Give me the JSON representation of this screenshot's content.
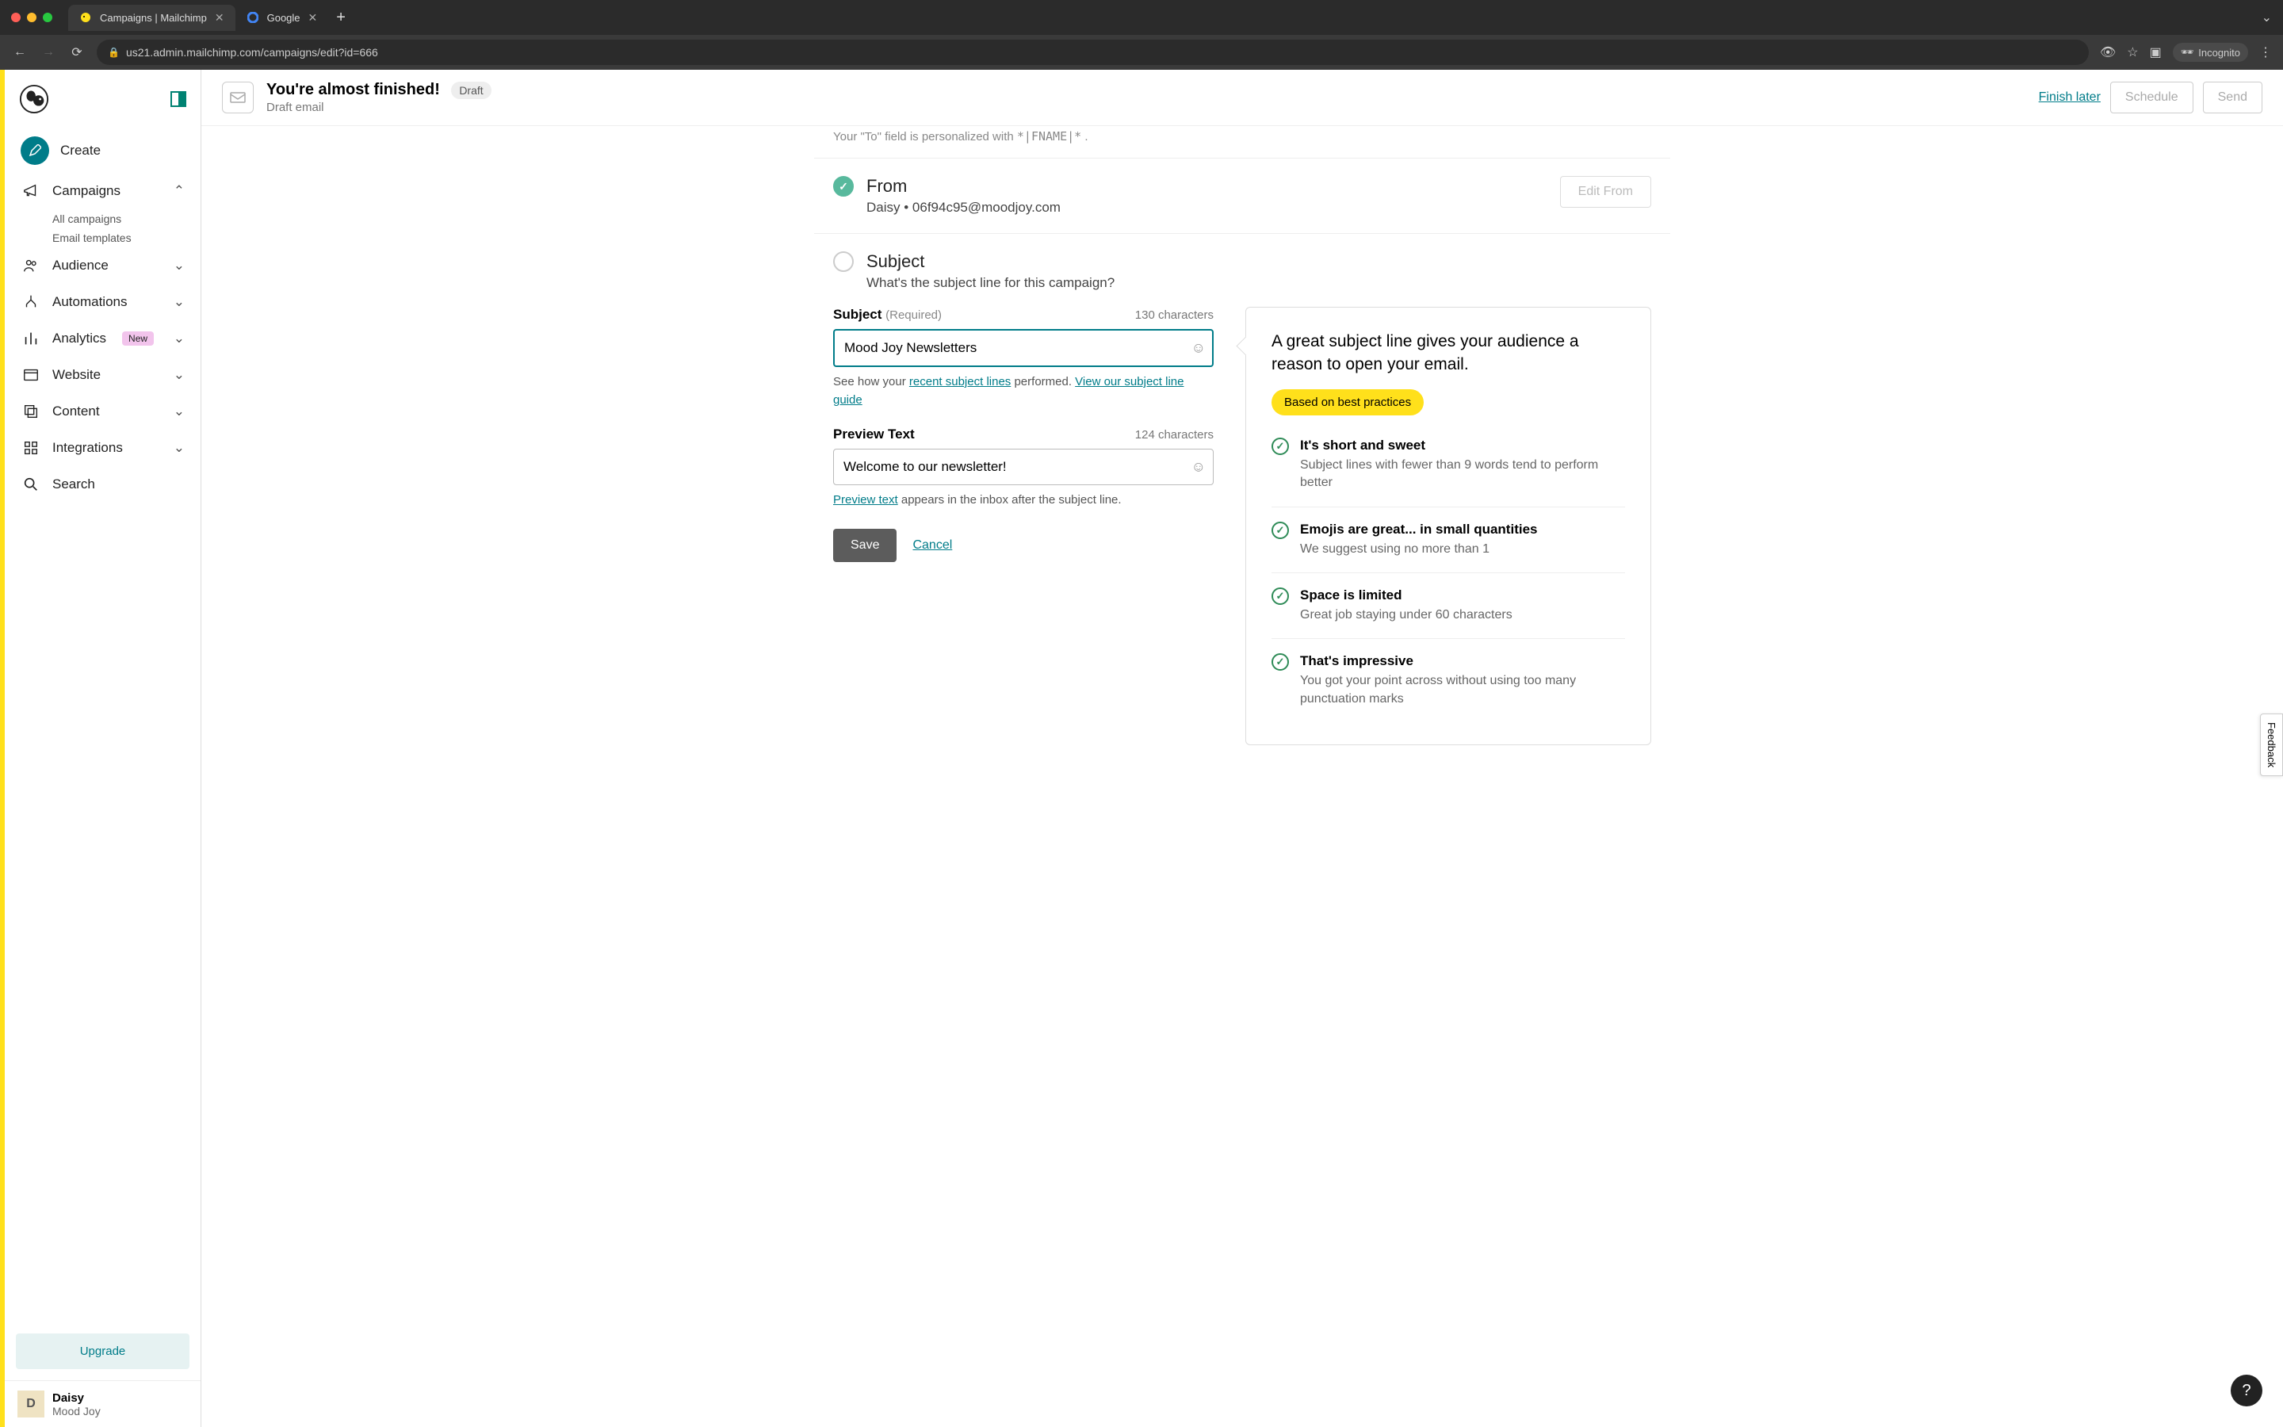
{
  "browser": {
    "tabs": [
      {
        "title": "Campaigns | Mailchimp",
        "active": true
      },
      {
        "title": "Google",
        "active": false
      }
    ],
    "url": "us21.admin.mailchimp.com/campaigns/edit?id=666",
    "incognito_label": "Incognito"
  },
  "sidebar": {
    "items": {
      "create": "Create",
      "campaigns": "Campaigns",
      "campaigns_sub": [
        "All campaigns",
        "Email templates"
      ],
      "audience": "Audience",
      "automations": "Automations",
      "analytics": "Analytics",
      "analytics_badge": "New",
      "website": "Website",
      "content": "Content",
      "integrations": "Integrations",
      "search": "Search"
    },
    "upgrade": "Upgrade",
    "user": {
      "initial": "D",
      "name": "Daisy",
      "org": "Mood Joy"
    }
  },
  "header": {
    "title": "You're almost finished!",
    "badge": "Draft",
    "subtitle": "Draft email",
    "finish_later": "Finish later",
    "schedule": "Schedule",
    "send": "Send"
  },
  "to_hint": {
    "prefix": "Your \"To\" field is personalized with ",
    "tag": "*|FNAME|*",
    "suffix": "."
  },
  "from": {
    "title": "From",
    "line": "Daisy • 06f94c95@moodjoy.com",
    "edit": "Edit From"
  },
  "subject": {
    "title": "Subject",
    "prompt": "What's the subject line for this campaign?",
    "field_label": "Subject",
    "required": "(Required)",
    "counter": "130 characters",
    "value": "Mood Joy Newsletters",
    "helper_prefix": "See how your ",
    "helper_link1": "recent subject lines",
    "helper_mid": " performed. ",
    "helper_link2": "View our subject line guide",
    "preview_label": "Preview Text",
    "preview_counter": "124 characters",
    "preview_value": "Welcome to our newsletter!",
    "preview_helper_link": "Preview text",
    "preview_helper_rest": " appears in the inbox after the subject line.",
    "save": "Save",
    "cancel": "Cancel"
  },
  "tips": {
    "heading": "A great subject line gives your audience a reason to open your email.",
    "pill": "Based on best practices",
    "items": [
      {
        "title": "It's short and sweet",
        "desc": "Subject lines with fewer than 9 words tend to perform better"
      },
      {
        "title": "Emojis are great... in small quantities",
        "desc": "We suggest using no more than 1"
      },
      {
        "title": "Space is limited",
        "desc": "Great job staying under 60 characters"
      },
      {
        "title": "That's impressive",
        "desc": "You got your point across without using too many punctuation marks"
      }
    ]
  },
  "feedback": "Feedback"
}
